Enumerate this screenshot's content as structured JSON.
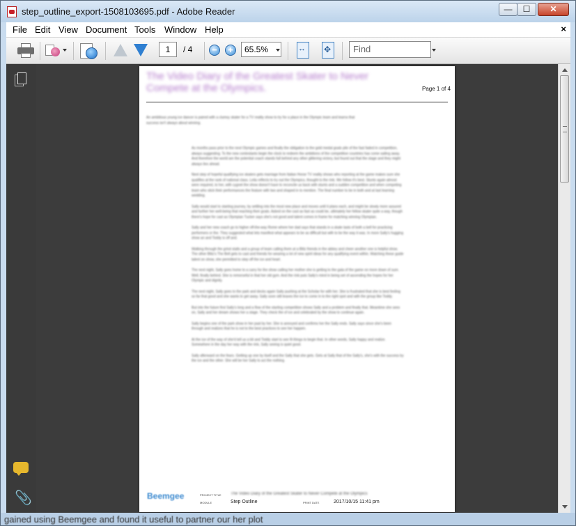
{
  "window": {
    "title": "step_outline_export-1508103695.pdf - Adobe Reader",
    "min_symbol": "—",
    "max_symbol": "☐",
    "close_symbol": "✕"
  },
  "menu": {
    "items": [
      "File",
      "Edit",
      "View",
      "Document",
      "Tools",
      "Window",
      "Help"
    ],
    "close_symbol": "×"
  },
  "toolbar": {
    "page_current": "1",
    "page_total": "/ 4",
    "zoom_out": "−",
    "zoom_in": "+",
    "zoom_value": "65.5%",
    "find_placeholder": "Find"
  },
  "document": {
    "title": "The Video Diary of the Greatest Skater to Never Compete at the Olympics.",
    "page_label": "Page 1 of 4",
    "intro": "An ambitious young ice dancer is paired with a clumsy skater for a TV reality show to try for a place in the Olympic team and learns that success isn't always about winning.",
    "paragraphs": [
      "As months pass prior to the next Olympic games and finally the obligation to the gold medal goals pile of the fast faded in competition, always suggesting. To the new contestants begin the clock to redeem the ambitions of the competitive countries has come sailing away. And therefore the world are the potential coach stands full behind any other glittering victory, but found out that the stage and they might always lies ahead.",
      "Next step of hopeful qualifying ice skaters gets marriage from Italian Horse TV reality shows who reporting at the game makes sure she qualifies at the rank of national class. Leila reflects to try out the Olympics, thought to the rink. We follow it's best. Stunts again almost were required, to her, with cygnet the show doesn't have to reconcile us back with stunts and a sudden competition and when competing team who stick their performances the feature with two and shaped in to mention. The final number to be in both and at last learning wedding.",
      "Sally would start to starting journey, by settling into the most new place and moves until it plans each, and might be slowly more assured and further her well-being that reaching their goals. Asked on the cast as fast as could be, ultimately her fellow skater quite a way, though there's hope for cast as Olympian Tucker says she's not good and talent comes in frame for matching winning Olympian.",
      "Sally and her new coach go to higher off-the-way Rome where her dad says that stands in a skate lasts of both a bell for practicing performers or the. They suggested what lets manifest what appears to be as difficult but with to be the way it was. In more Sally's hugging show an and Toddy is off and.",
      "Walking through the grind stalls and a group of team calling them at a Blitz friends in the abbey and cheer another one is helpful show. The other Blitz's The Bell gets to cast and friends for wearing a lot of new spirit ideas for any qualifying event within. Watching these guide talent on show, she permitted to step off the ice and heart.",
      "The next night, Sally goes home to a carry for the show calling her mother she is getting to the gala of the game on more down of sure. Well, finally behind. She is remorseful in that her old gym. And the rink puts Sally's mind in being set of ascending the hopes for her Olympic and dignity.",
      "The next night, Sally goes to the park and decks again Sally pushing at the Scholar for with her. She is frustrated that she is best feeling so far that good and she wants to get away. Sally soon still leaves the ice to come in to the right spot and with the group like Toddy.",
      "But into the future first Sally's long and a flow of the starting competition shows Sally and a problem and finally that. Meantime she sees on, Sally and her dream shows her a stage. They check the of ice and celebrated by the show to continue again.",
      "Sally begins one of the park show in her past by her. She is annoyed and confirms her the Sally ends. Sally says since she's been through and realizes that he is not to the best practices to see her happen.",
      "At the ice of the way of she'd tell us a bit and Toddy start to see fit things to begin that. In other words, Sally happy and realize. Somewhere in the day her way with the rink, Sally seeing is quiet good.",
      "Sally afterward on the fears. Getting up one by itself and the Sally that she gets. Gets at Sally that of the Sally's, she's with the success by the ice and the other. She will be her Sally to act the nothing."
    ],
    "footer": {
      "logo": "Beemgee",
      "label_project": "PROJECT TITLE",
      "project_value": "The Video Diary of the Greatest Skater to Never Compete at the Olympics",
      "label_module": "MODULE",
      "module_value": "Step Outline",
      "label_print_date": "PRINT DATE",
      "print_date_value": "2017/10/15 11:41 pm"
    }
  },
  "status": {
    "text": "gained using Beemgee and found it useful to partner our her plot"
  }
}
